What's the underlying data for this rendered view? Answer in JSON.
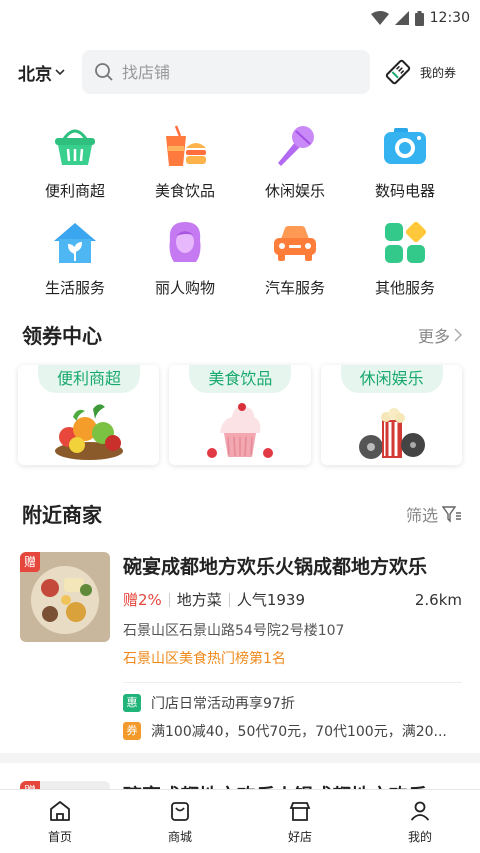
{
  "status": {
    "time": "12:30"
  },
  "header": {
    "city": "北京",
    "search_placeholder": "找店铺",
    "my_coupons": "我的券"
  },
  "categories": [
    {
      "label": "便利商超",
      "icon": "basket-icon"
    },
    {
      "label": "美食饮品",
      "icon": "food-drink-icon"
    },
    {
      "label": "休闲娱乐",
      "icon": "microphone-icon"
    },
    {
      "label": "数码电器",
      "icon": "camera-icon"
    },
    {
      "label": "生活服务",
      "icon": "house-icon"
    },
    {
      "label": "丽人购物",
      "icon": "woman-icon"
    },
    {
      "label": "汽车服务",
      "icon": "car-icon"
    },
    {
      "label": "其他服务",
      "icon": "grid-icon"
    }
  ],
  "coupon_center": {
    "title": "领券中心",
    "more": "更多",
    "cards": [
      {
        "label": "便利商超"
      },
      {
        "label": "美食饮品"
      },
      {
        "label": "休闲娱乐"
      }
    ]
  },
  "nearby": {
    "title": "附近商家",
    "filter": "筛选",
    "merchants": [
      {
        "gift_badge": "赠",
        "name": "碗宴成都地方欢乐火锅成都地方欢乐",
        "gift": "赠2%",
        "category": "地方菜",
        "popularity": "人气1939",
        "distance": "2.6km",
        "address": "石景山区石景山路54号院2号楼107",
        "rank": "石景山区美食热门榜第1名",
        "promos": [
          {
            "badge": "惠",
            "text": "门店日常活动再享97折",
            "color": "#20b37a"
          },
          {
            "badge": "券",
            "text": "满100减40，50代70元，70代100元，满20...",
            "color": "#f39a2b"
          }
        ]
      },
      {
        "name": "碗宴成都地方欢乐火锅成都地方欢乐"
      }
    ]
  },
  "tabbar": [
    {
      "label": "首页"
    },
    {
      "label": "商城"
    },
    {
      "label": "好店"
    },
    {
      "label": "我的"
    }
  ]
}
